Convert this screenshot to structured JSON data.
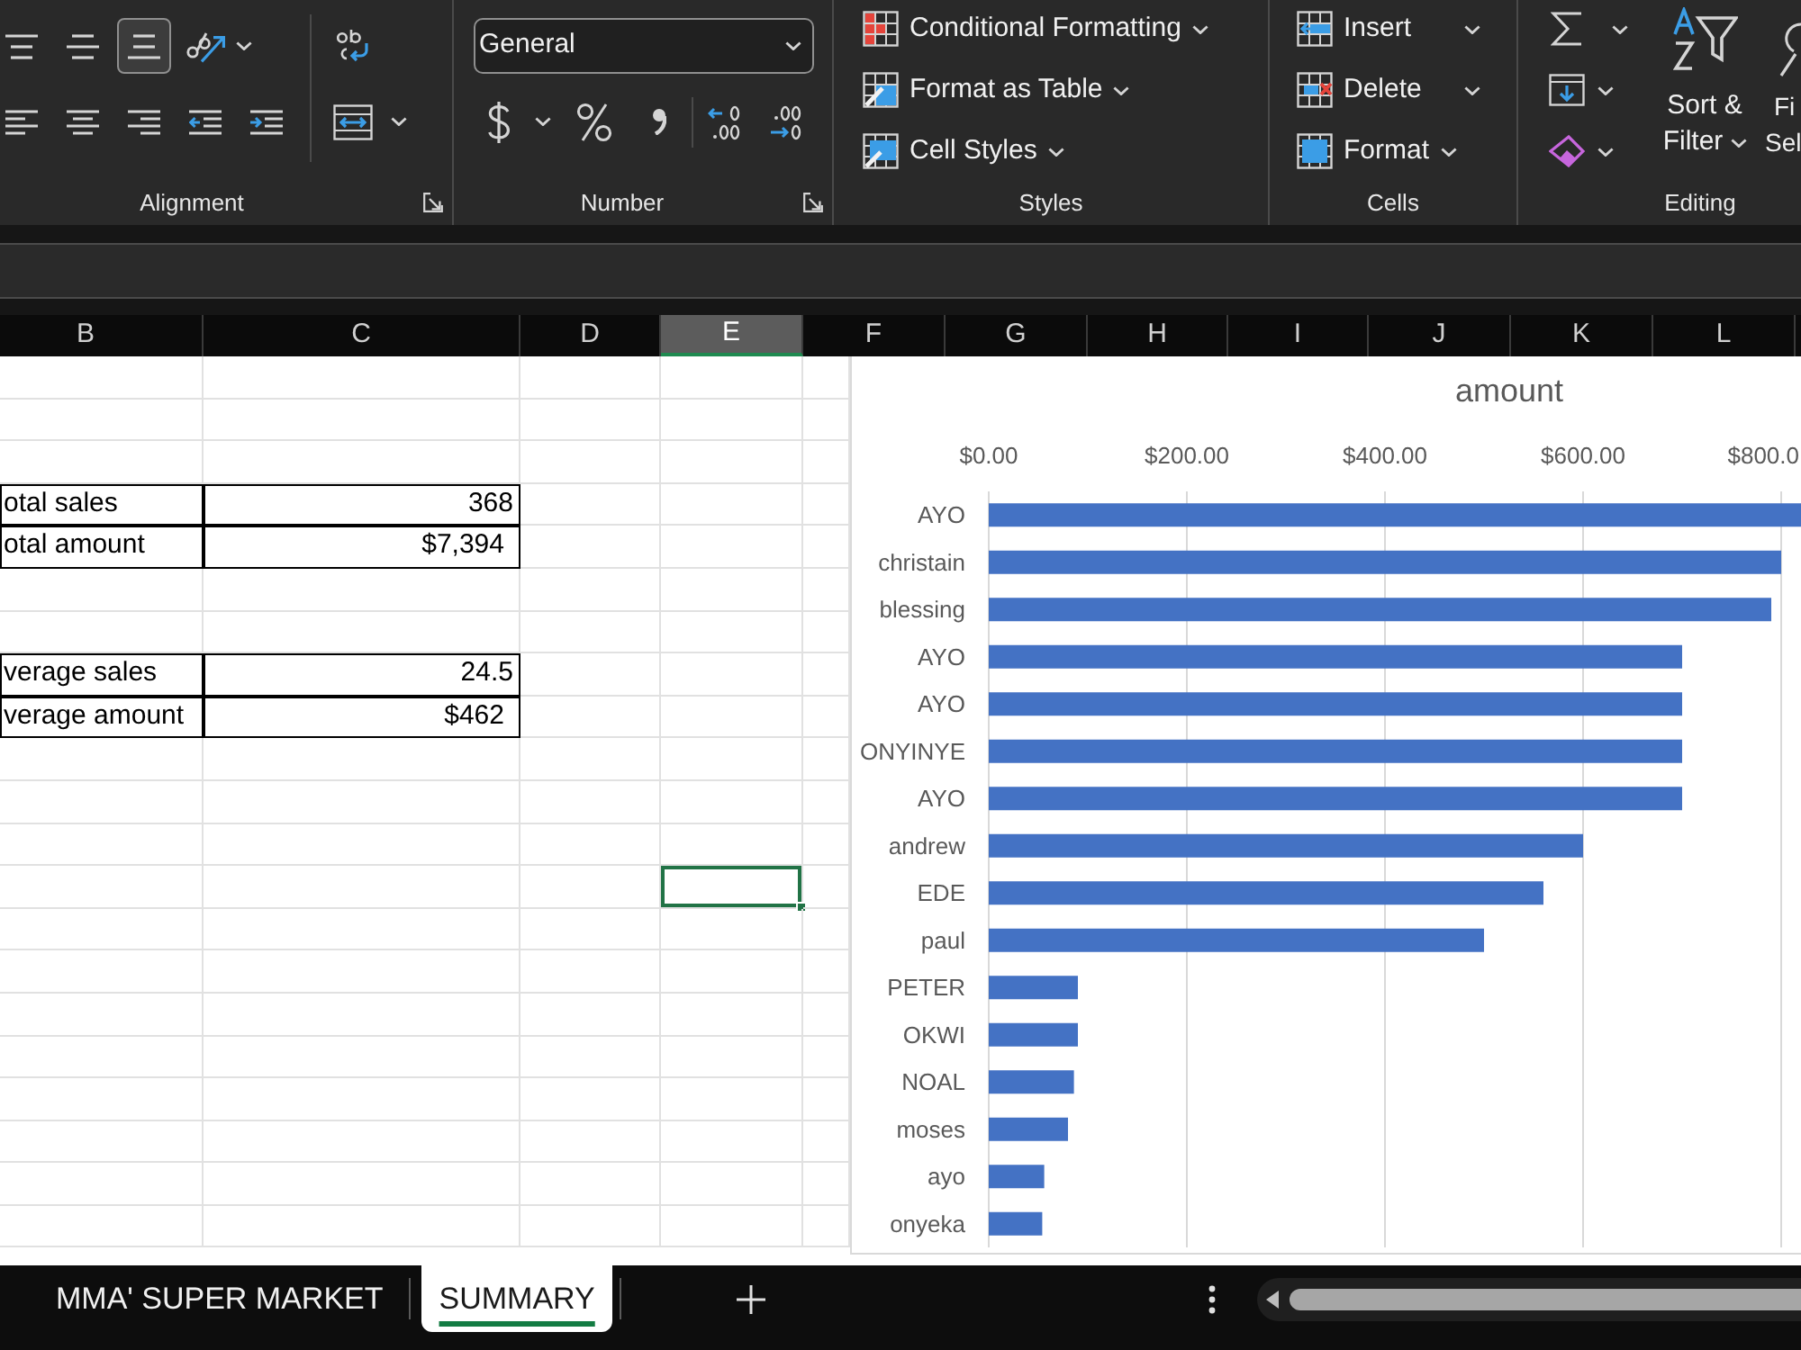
{
  "ribbon": {
    "alignment": {
      "label": "Alignment",
      "vertical_align": [
        {
          "kind": "top",
          "selected": false
        },
        {
          "kind": "middle",
          "selected": false
        },
        {
          "kind": "bottom",
          "selected": true
        }
      ]
    },
    "number": {
      "label": "Number",
      "format": "General"
    },
    "styles": {
      "label": "Styles",
      "items": [
        {
          "label": "Conditional Formatting",
          "kind": "conditional"
        },
        {
          "label": "Format as Table",
          "kind": "table"
        },
        {
          "label": "Cell Styles",
          "kind": "cell_styles"
        }
      ]
    },
    "cells": {
      "label": "Cells",
      "items": [
        {
          "label": "Insert",
          "kind": "insert"
        },
        {
          "label": "Delete",
          "kind": "delete"
        },
        {
          "label": "Format",
          "kind": "format"
        }
      ]
    },
    "editing": {
      "label": "Editing",
      "sort_filter": [
        "Sort &",
        "Filter"
      ],
      "find_select": [
        "Fi",
        "Sel"
      ]
    }
  },
  "sheet": {
    "columns": [
      {
        "label": "B",
        "selected": false
      },
      {
        "label": "C",
        "selected": false
      },
      {
        "label": "D",
        "selected": false
      },
      {
        "label": "E",
        "selected": true
      },
      {
        "label": "F",
        "selected": false
      },
      {
        "label": "G",
        "selected": false
      },
      {
        "label": "H",
        "selected": false
      },
      {
        "label": "I",
        "selected": false
      },
      {
        "label": "J",
        "selected": false
      },
      {
        "label": "K",
        "selected": false
      },
      {
        "label": "L",
        "selected": false
      }
    ],
    "rows": [
      {
        "cells": [
          {
            "boxed": false,
            "selected": false
          },
          {
            "boxed": false,
            "selected": false
          },
          {
            "boxed": false,
            "selected": false
          },
          {
            "boxed": false,
            "selected": false
          },
          {
            "boxed": false,
            "selected": false
          }
        ]
      },
      {
        "cells": [
          {
            "boxed": false,
            "selected": false
          },
          {
            "boxed": false,
            "selected": false
          },
          {
            "boxed": false,
            "selected": false
          },
          {
            "boxed": false,
            "selected": false
          },
          {
            "boxed": false,
            "selected": false
          }
        ]
      },
      {
        "cells": [
          {
            "boxed": false,
            "selected": false
          },
          {
            "boxed": false,
            "selected": false
          },
          {
            "boxed": false,
            "selected": false
          },
          {
            "boxed": false,
            "selected": false
          },
          {
            "boxed": false,
            "selected": false
          }
        ]
      },
      {
        "cells": [
          {
            "text": "otal sales",
            "kind": "text",
            "boxed": true,
            "selected": false
          },
          {
            "text": "368",
            "kind": "number",
            "boxed": true,
            "selected": false
          },
          {
            "boxed": false,
            "selected": false
          },
          {
            "boxed": false,
            "selected": false
          },
          {
            "boxed": false,
            "selected": false
          }
        ]
      },
      {
        "cells": [
          {
            "text": "otal amount",
            "kind": "text",
            "boxed": true,
            "selected": false
          },
          {
            "text": "$7,394",
            "kind": "currency",
            "boxed": true,
            "selected": false
          },
          {
            "boxed": false,
            "selected": false
          },
          {
            "boxed": false,
            "selected": false
          },
          {
            "boxed": false,
            "selected": false
          }
        ]
      },
      {
        "cells": [
          {
            "boxed": false,
            "selected": false
          },
          {
            "boxed": false,
            "selected": false
          },
          {
            "boxed": false,
            "selected": false
          },
          {
            "boxed": false,
            "selected": false
          },
          {
            "boxed": false,
            "selected": false
          }
        ]
      },
      {
        "cells": [
          {
            "boxed": false,
            "selected": false
          },
          {
            "boxed": false,
            "selected": false
          },
          {
            "boxed": false,
            "selected": false
          },
          {
            "boxed": false,
            "selected": false
          },
          {
            "boxed": false,
            "selected": false
          }
        ]
      },
      {
        "cells": [
          {
            "text": "verage sales",
            "kind": "text",
            "boxed": true,
            "selected": false
          },
          {
            "text": "24.5",
            "kind": "number",
            "boxed": true,
            "selected": false
          },
          {
            "boxed": false,
            "selected": false
          },
          {
            "boxed": false,
            "selected": false
          },
          {
            "boxed": false,
            "selected": false
          }
        ]
      },
      {
        "cells": [
          {
            "text": "verage amount",
            "kind": "text",
            "boxed": true,
            "selected": false
          },
          {
            "text": "$462",
            "kind": "currency",
            "boxed": true,
            "selected": false
          },
          {
            "boxed": false,
            "selected": false
          },
          {
            "boxed": false,
            "selected": false
          },
          {
            "boxed": false,
            "selected": false
          }
        ]
      },
      {
        "cells": [
          {
            "boxed": false,
            "selected": false
          },
          {
            "boxed": false,
            "selected": false
          },
          {
            "boxed": false,
            "selected": false
          },
          {
            "boxed": false,
            "selected": false
          },
          {
            "boxed": false,
            "selected": false
          }
        ]
      },
      {
        "cells": [
          {
            "boxed": false,
            "selected": false
          },
          {
            "boxed": false,
            "selected": false
          },
          {
            "boxed": false,
            "selected": false
          },
          {
            "boxed": false,
            "selected": false
          },
          {
            "boxed": false,
            "selected": false
          }
        ]
      },
      {
        "cells": [
          {
            "boxed": false,
            "selected": false
          },
          {
            "boxed": false,
            "selected": false
          },
          {
            "boxed": false,
            "selected": false
          },
          {
            "boxed": false,
            "selected": false
          },
          {
            "boxed": false,
            "selected": false
          }
        ]
      },
      {
        "cells": [
          {
            "boxed": false,
            "selected": false
          },
          {
            "boxed": false,
            "selected": false
          },
          {
            "boxed": false,
            "selected": false
          },
          {
            "boxed": false,
            "selected": true
          },
          {
            "boxed": false,
            "selected": false
          }
        ]
      },
      {
        "cells": [
          {
            "boxed": false,
            "selected": false
          },
          {
            "boxed": false,
            "selected": false
          },
          {
            "boxed": false,
            "selected": false
          },
          {
            "boxed": false,
            "selected": false
          },
          {
            "boxed": false,
            "selected": false
          }
        ]
      },
      {
        "cells": [
          {
            "boxed": false,
            "selected": false
          },
          {
            "boxed": false,
            "selected": false
          },
          {
            "boxed": false,
            "selected": false
          },
          {
            "boxed": false,
            "selected": false
          },
          {
            "boxed": false,
            "selected": false
          }
        ]
      },
      {
        "cells": [
          {
            "boxed": false,
            "selected": false
          },
          {
            "boxed": false,
            "selected": false
          },
          {
            "boxed": false,
            "selected": false
          },
          {
            "boxed": false,
            "selected": false
          },
          {
            "boxed": false,
            "selected": false
          }
        ]
      },
      {
        "cells": [
          {
            "boxed": false,
            "selected": false
          },
          {
            "boxed": false,
            "selected": false
          },
          {
            "boxed": false,
            "selected": false
          },
          {
            "boxed": false,
            "selected": false
          },
          {
            "boxed": false,
            "selected": false
          }
        ]
      },
      {
        "cells": [
          {
            "boxed": false,
            "selected": false
          },
          {
            "boxed": false,
            "selected": false
          },
          {
            "boxed": false,
            "selected": false
          },
          {
            "boxed": false,
            "selected": false
          },
          {
            "boxed": false,
            "selected": false
          }
        ]
      },
      {
        "cells": [
          {
            "boxed": false,
            "selected": false
          },
          {
            "boxed": false,
            "selected": false
          },
          {
            "boxed": false,
            "selected": false
          },
          {
            "boxed": false,
            "selected": false
          },
          {
            "boxed": false,
            "selected": false
          }
        ]
      },
      {
        "cells": [
          {
            "boxed": false,
            "selected": false
          },
          {
            "boxed": false,
            "selected": false
          },
          {
            "boxed": false,
            "selected": false
          },
          {
            "boxed": false,
            "selected": false
          },
          {
            "boxed": false,
            "selected": false
          }
        ]
      },
      {
        "cells": [
          {
            "boxed": false,
            "selected": false
          },
          {
            "boxed": false,
            "selected": false
          },
          {
            "boxed": false,
            "selected": false
          },
          {
            "boxed": false,
            "selected": false
          },
          {
            "boxed": false,
            "selected": false
          }
        ]
      }
    ],
    "chart": {
      "chart_data": {
        "type": "bar",
        "orientation": "horizontal",
        "title": "amount",
        "grid": true,
        "categories": [
          "AYO",
          "christain",
          "blessing",
          "AYO",
          "AYO",
          "ONYINYE",
          "AYO",
          "andrew",
          "EDE",
          "paul",
          "PETER",
          "OKWI",
          "NOAL",
          "moses",
          "ayo",
          "onyeka"
        ],
        "series": [
          {
            "color": "#4472c4",
            "values": [
              820,
              800,
              790,
              700,
              700,
              700,
              700,
              600,
              560,
              500,
              90,
              90,
              86,
              80,
              56,
              54
            ]
          }
        ],
        "xlim": [
          0,
          820
        ],
        "xticks": [
          {
            "value": 0,
            "label": "$0.00"
          },
          {
            "value": 200,
            "label": "$200.00"
          },
          {
            "value": 400,
            "label": "$400.00"
          },
          {
            "value": 600,
            "label": "$600.00"
          },
          {
            "value": 800,
            "label": "$800.0"
          }
        ]
      }
    }
  },
  "sheet_tabs": [
    {
      "label": "MMA' SUPER MARKET",
      "selected": false
    },
    {
      "label": "SUMMARY",
      "selected": true
    }
  ]
}
